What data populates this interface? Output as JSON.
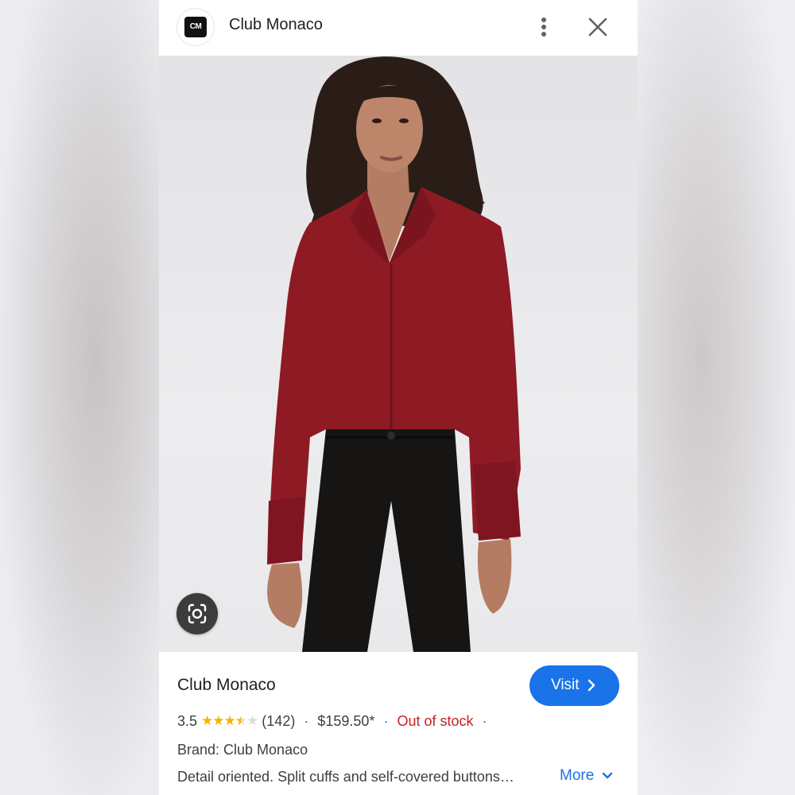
{
  "header": {
    "logo_text": "CM",
    "site_name": "Club Monaco",
    "icons": [
      "more-vert-icon",
      "close-icon"
    ]
  },
  "image": {
    "description_icon": "google-lens-icon",
    "colors": {
      "blouse": "#8e1a24",
      "pants": "#161514",
      "background": "#e8e8ea"
    }
  },
  "product": {
    "title": "Club Monaco",
    "visit_label": "Visit",
    "rating": "3.5",
    "rating_value": 3.5,
    "review_count": "(142)",
    "price": "$159.50*",
    "stock_status": "Out of stock",
    "separator": "·",
    "brand": "Brand: Club Monaco",
    "description": "Detail oriented. Split cuffs and self-covered buttons…",
    "more_label": "More"
  },
  "colors": {
    "accent": "#1a73e8",
    "out_of_stock": "#c5221f",
    "star": "#f5b400"
  }
}
